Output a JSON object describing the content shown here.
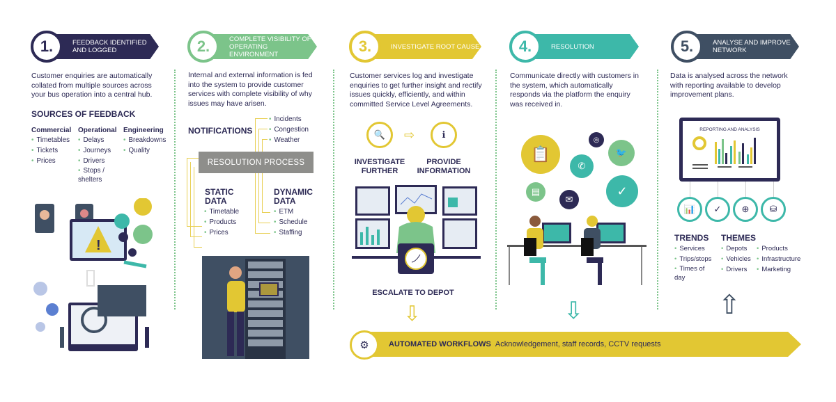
{
  "colors": {
    "step1": "#2d2a55",
    "step2": "#7cc48a",
    "step3": "#e2c733",
    "step4": "#3db8a9",
    "step5": "#3f4f63",
    "text": "#2d2a55"
  },
  "steps": [
    {
      "number": "1.",
      "title": "Feedback identified and logged",
      "description": "Customer enquiries are automatically collated from multiple sources across your bus operation into a central hub."
    },
    {
      "number": "2.",
      "title": "Complete visibility of operating environment",
      "description": "Internal and external information is fed into the system to provide customer services with complete visibility of why issues may have arisen."
    },
    {
      "number": "3.",
      "title": "Investigate root cause",
      "description": "Customer services log and investigate enquiries to get further insight and rectify issues quickly, efficiently, and within committed Service Level Agreements."
    },
    {
      "number": "4.",
      "title": "Resolution",
      "description": "Communicate directly with customers in the system, which automatically responds via the platform the enquiry was received in."
    },
    {
      "number": "5.",
      "title": "Analyse and improve network",
      "description": "Data is analysed across the network with reporting available to develop improvement plans."
    }
  ],
  "sources": {
    "heading": "SOURCES OF FEEDBACK",
    "columns": [
      {
        "title": "Commercial",
        "items": [
          "Timetables",
          "Tickets",
          "Prices"
        ]
      },
      {
        "title": "Operational",
        "items": [
          "Delays",
          "Journeys",
          "Drivers",
          "Stops / shelters"
        ]
      },
      {
        "title": "Engineering",
        "items": [
          "Breakdowns",
          "Quality"
        ]
      }
    ]
  },
  "visibility": {
    "notifications_heading": "NOTIFICATIONS",
    "notifications": [
      "Incidents",
      "Congestion",
      "Weather"
    ],
    "process_label": "RESOLUTION PROCESS",
    "static_heading": "STATIC DATA",
    "static_items": [
      "Timetable",
      "Products",
      "Prices"
    ],
    "dynamic_heading": "DYNAMIC DATA",
    "dynamic_items": [
      "ETM",
      "Schedule",
      "Staffing"
    ]
  },
  "investigate": {
    "investigate_label": "INVESTIGATE FURTHER",
    "provide_label": "PROVIDE INFORMATION",
    "escalate_label": "ESCALATE TO DEPOT"
  },
  "analyse": {
    "report_title": "REPORTING AND ANALYSIS",
    "trends_heading": "TRENDS",
    "trends": [
      "Services",
      "Trips/stops",
      "Times of day"
    ],
    "themes_heading": "THEMES",
    "themes_col1": [
      "Depots",
      "Vehicles",
      "Drivers"
    ],
    "themes_col2": [
      "Products",
      "Infrastructure",
      "Marketing"
    ]
  },
  "workflow": {
    "title": "AUTOMATED WORKFLOWS",
    "text": "Acknowledgement, staff records, CCTV requests"
  }
}
